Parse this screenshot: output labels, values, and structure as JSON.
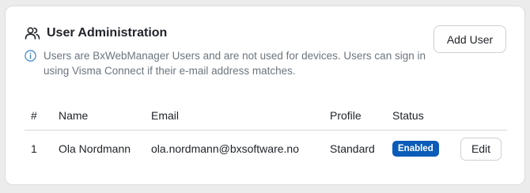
{
  "panel": {
    "title": "User Administration",
    "title_icon": "users-icon",
    "info_icon": "info-circle-icon",
    "info_text": "Users are BxWebManager Users and are not used for devices. Users can sign in using Visma Connect if their e-mail address matches.",
    "add_button_label": "Add User"
  },
  "table": {
    "columns": [
      "#",
      "Name",
      "Email",
      "Profile",
      "Status",
      ""
    ],
    "rows": [
      {
        "num": "1",
        "name": "Ola Nordmann",
        "email": "ola.nordmann@bxsoftware.no",
        "profile": "Standard",
        "status": "Enabled",
        "action_label": "Edit"
      }
    ]
  },
  "colors": {
    "badge_background": "#0a5cb8",
    "info_icon": "#3b82c4",
    "page_background": "#ececec"
  }
}
